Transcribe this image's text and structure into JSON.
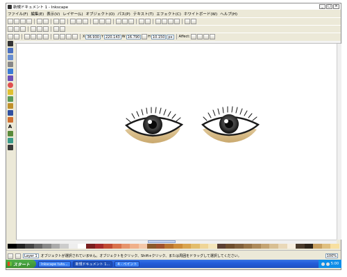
{
  "window": {
    "title": "新規ドキュメント 1 - Inkscape"
  },
  "menu": [
    "ファイル(F)",
    "編集(E)",
    "表示(V)",
    "レイヤー(L)",
    "オブジェクト(O)",
    "パス(P)",
    "テキスト(T)",
    "エフェクト(C)",
    "ホワイトボード(W)",
    "ヘルプ(H)"
  ],
  "toolbar3": {
    "x_value": "36.930",
    "y_value": "220.143",
    "w_value": "16.790",
    "h_value": "10.150",
    "unit": "px",
    "affect_label": "Affect:"
  },
  "status": {
    "layer": "Layer 1",
    "message": "オブジェクトが選択されていません。オブジェクトをクリック、Shift+クリック、または周囲をドラッグして選択してください。",
    "zoom": "100%"
  },
  "taskbar": {
    "start_label": "スタート",
    "tasks": [
      "Inkscape tuto...",
      "新規ドキュメント 1...",
      "4 - ペイント"
    ],
    "clock": "5:00"
  },
  "colors": {
    "palette": [
      "#000000",
      "#222222",
      "#444444",
      "#666666",
      "#888888",
      "#aaaaaa",
      "#cccccc",
      "#eeeeee",
      "#ffffff",
      "#7a1f1f",
      "#a52a2a",
      "#c04a32",
      "#d9724b",
      "#e6946b",
      "#f0b08a",
      "#f5c8a8",
      "#8b5a2b",
      "#a0522d",
      "#b8732f",
      "#cd8c3a",
      "#d9a44f",
      "#e3bd6b",
      "#efd597",
      "#f5e6bb",
      "#5c4033",
      "#6f4f2f",
      "#80603c",
      "#977448",
      "#ad8a5a",
      "#c4a473",
      "#d8bf93",
      "#e9d8b8",
      "#f7efe0",
      "#4a3a2a",
      "#2e2418",
      "#c8a060",
      "#e0c080",
      "#f8e0a0"
    ]
  }
}
